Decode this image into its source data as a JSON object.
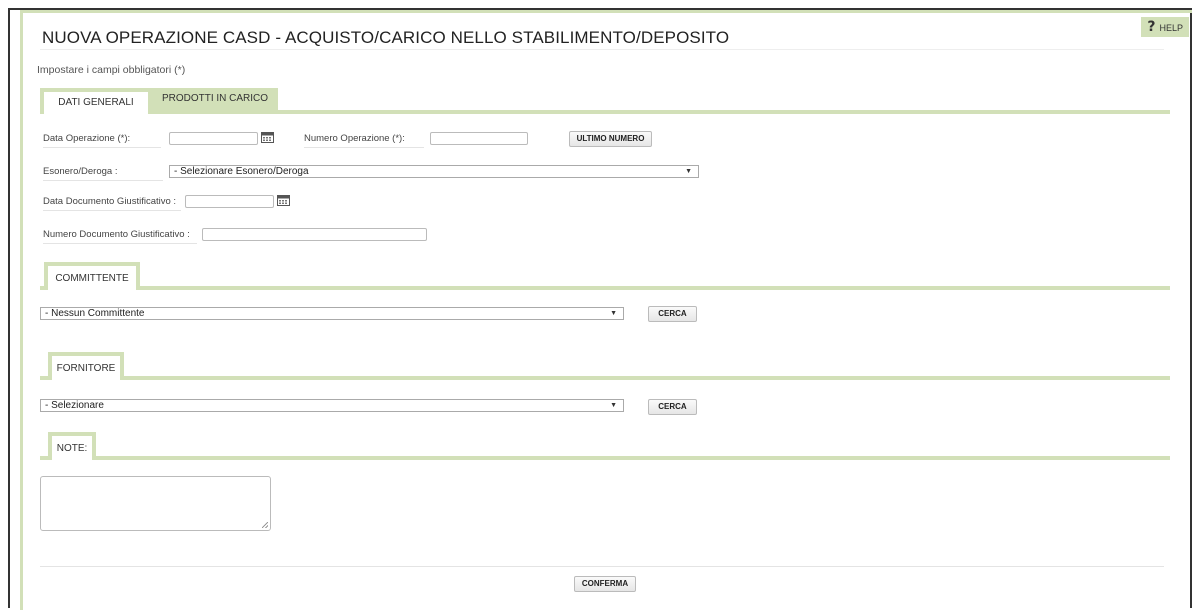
{
  "help": {
    "label": "HELP",
    "glyph": "?"
  },
  "page": {
    "title": "NUOVA OPERAZIONE CASD - ACQUISTO/CARICO NELLO STABILIMENTO/DEPOSITO",
    "subtitle": "Impostare i campi obbligatori (*)"
  },
  "tabs": [
    {
      "label": "DATI GENERALI",
      "active": true
    },
    {
      "label": "PRODOTTI IN CARICO",
      "active": false
    }
  ],
  "general": {
    "data_operazione_label": "Data Operazione (*):",
    "data_operazione_value": "",
    "numero_operazione_label": "Numero Operazione (*):",
    "numero_operazione_value": "",
    "ultimo_numero_button": "ULTIMO NUMERO",
    "esonero_label": "Esonero/Deroga :",
    "esonero_selected": "- Selezionare Esonero/Deroga",
    "data_documento_label": "Data Documento Giustificativo :",
    "data_documento_value": "",
    "numero_documento_label": "Numero Documento Giustificativo :",
    "numero_documento_value": ""
  },
  "committente": {
    "section_label": "COMMITTENTE",
    "selected": "- Nessun Committente",
    "search_button": "CERCA"
  },
  "fornitore": {
    "section_label": "FORNITORE",
    "selected": "- Selezionare",
    "search_button": "CERCA"
  },
  "note": {
    "section_label": "NOTE:",
    "value": ""
  },
  "footer": {
    "confirm_button": "CONFERMA"
  },
  "icons": {
    "calendar": "calendar-icon",
    "dropdown": "dropdown-arrow-icon",
    "help": "help-icon"
  },
  "colors": {
    "accent": "#d2e0b8",
    "frame": "#333333",
    "text": "#333333"
  }
}
